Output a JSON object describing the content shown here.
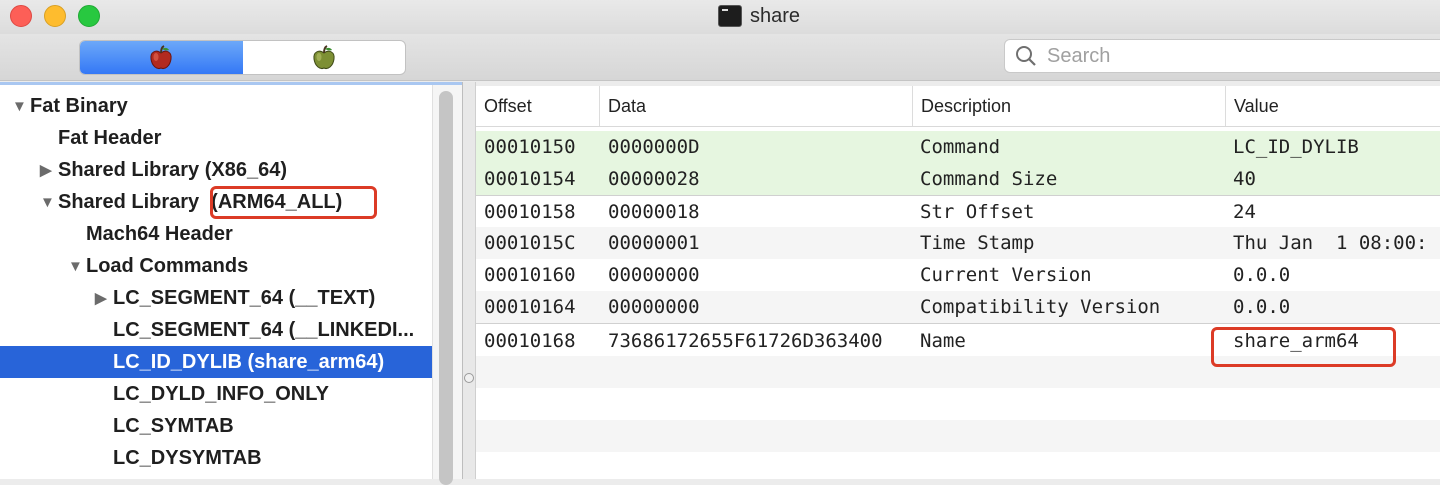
{
  "window": {
    "title": "share"
  },
  "toolbar": {
    "segments": [
      {
        "icon": "red-apple-icon",
        "selected": true
      },
      {
        "icon": "green-apple-icon",
        "selected": false
      }
    ],
    "search_placeholder": "Search"
  },
  "tree": [
    {
      "label": "Fat Binary",
      "arrow": "▼"
    },
    {
      "label": "Fat Header",
      "arrow": ""
    },
    {
      "label": "Shared Library  (X86_64)",
      "arrow": "▶"
    },
    {
      "label": "Shared Library",
      "suffix": "(ARM64_ALL)",
      "arrow": "▼"
    },
    {
      "label": "Mach64 Header",
      "arrow": ""
    },
    {
      "label": "Load Commands",
      "arrow": "▼"
    },
    {
      "label": "LC_SEGMENT_64 (__TEXT)",
      "arrow": "▶"
    },
    {
      "label": "LC_SEGMENT_64 (__LINKEDI...",
      "arrow": ""
    },
    {
      "label": "LC_ID_DYLIB (share_arm64)",
      "arrow": "",
      "selected": true
    },
    {
      "label": "LC_DYLD_INFO_ONLY",
      "arrow": ""
    },
    {
      "label": "LC_SYMTAB",
      "arrow": ""
    },
    {
      "label": "LC_DYSYMTAB",
      "arrow": ""
    }
  ],
  "table": {
    "headers": {
      "offset": "Offset",
      "data": "Data",
      "description": "Description",
      "value": "Value"
    },
    "rows": [
      {
        "offset": "00010150",
        "data": "0000000D",
        "description": "Command",
        "value": "LC_ID_DYLIB"
      },
      {
        "offset": "00010154",
        "data": "00000028",
        "description": "Command Size",
        "value": "40"
      },
      {
        "offset": "00010158",
        "data": "00000018",
        "description": "Str Offset",
        "value": "24"
      },
      {
        "offset": "0001015C",
        "data": "00000001",
        "description": "Time Stamp",
        "value": "Thu Jan  1 08:00:"
      },
      {
        "offset": "00010160",
        "data": "00000000",
        "description": "Current Version",
        "value": "0.0.0"
      },
      {
        "offset": "00010164",
        "data": "00000000",
        "description": "Compatibility Version",
        "value": "0.0.0"
      },
      {
        "offset": "00010168",
        "data": "73686172655F61726D363400",
        "description": "Name",
        "value": "share_arm64"
      }
    ]
  },
  "colors": {
    "selection": "#2864d9",
    "highlight_row": "#e6f6e0",
    "annotation": "#dc3b26",
    "segment_active": "#3478f6"
  }
}
